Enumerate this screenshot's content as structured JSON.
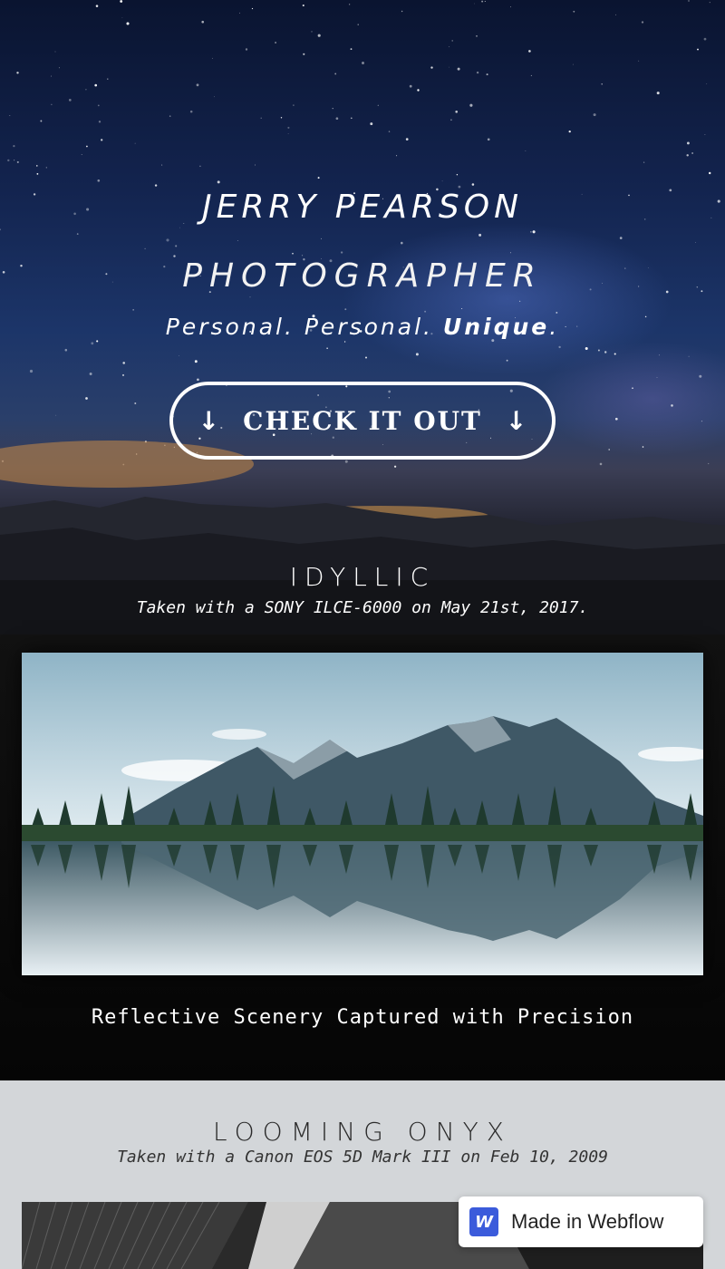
{
  "hero": {
    "title": "JERRY PEARSON",
    "subtitle": "PHOTOGRAPHER",
    "tagline_start": "Personal. Personal. ",
    "tagline_bold": "Unique",
    "tagline_end": ".",
    "cta_label": "CHECK IT OUT",
    "cta_arrow": "↓"
  },
  "hero_caption": {
    "title": "IDYLLIC",
    "meta": "Taken with a SONY ILCE-6000 on May 21st, 2017."
  },
  "featured": {
    "caption": "Reflective Scenery Captured with Precision"
  },
  "second": {
    "title": "LOOMING ONYX",
    "meta": "Taken with a Canon EOS 5D Mark III on Feb 10, 2009"
  },
  "badge": {
    "logo": "W",
    "label": "Made in Webflow"
  },
  "colors": {
    "badge_logo": "#3b5bdb",
    "second_bg": "#d3d6d9",
    "featured_bg": "#0b0b0b"
  }
}
